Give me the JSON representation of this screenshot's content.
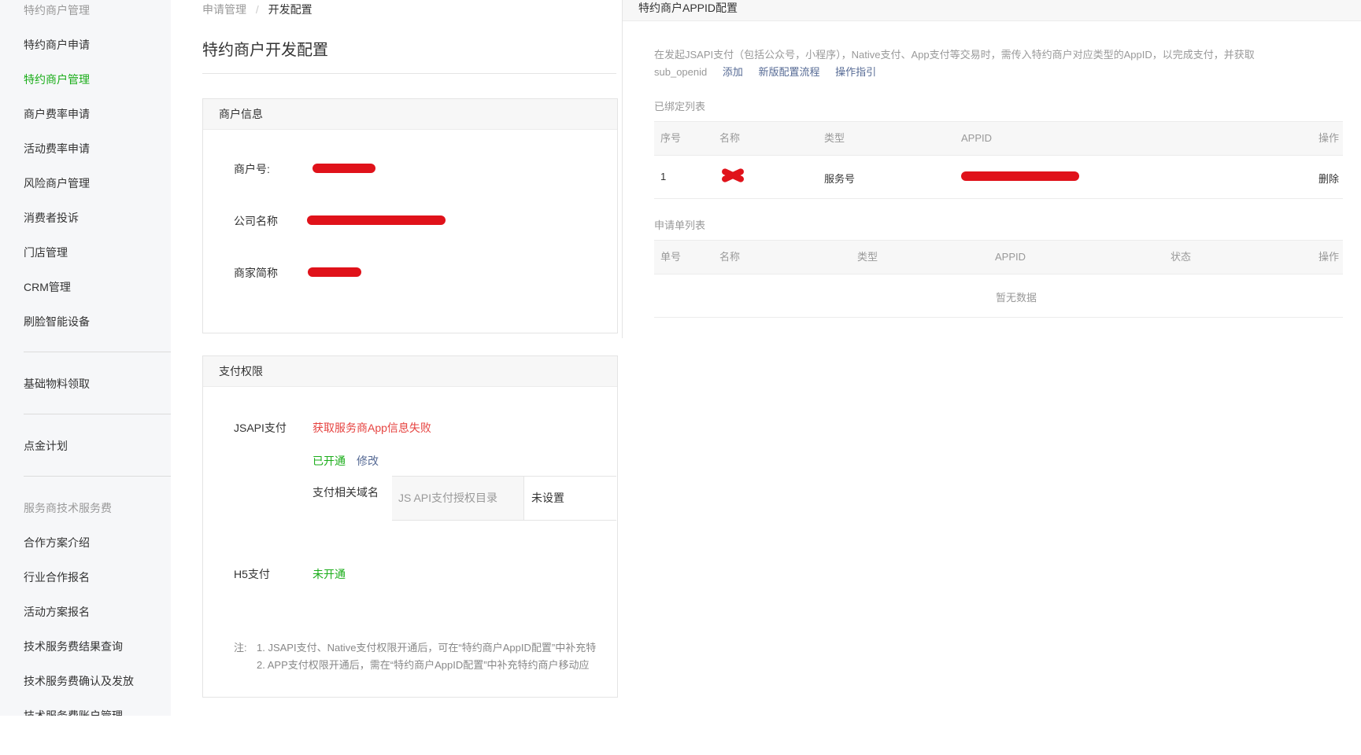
{
  "sidebar": {
    "section1_title": "特约商户管理",
    "items1": [
      "特约商户申请",
      "特约商户管理",
      "商户费率申请",
      "活动费率申请",
      "风险商户管理",
      "消费者投诉",
      "门店管理",
      "CRM管理",
      "刷脸智能设备"
    ],
    "item_basic": "基础物料领取",
    "item_gold": "点金计划",
    "section2_title": "服务商技术服务费",
    "items2": [
      "合作方案介绍",
      "行业合作报名",
      "活动方案报名",
      "技术服务费结果查询",
      "技术服务费确认及发放",
      "技术服务费账户管理"
    ]
  },
  "breadcrumb": {
    "parent": "申请管理",
    "sep": "/",
    "current": "开发配置"
  },
  "page_title": "特约商户开发配置",
  "merchant_info": {
    "title": "商户信息",
    "merchant_no_label": "商户号:",
    "company_label": "公司名称",
    "short_name_label": "商家简称"
  },
  "pay_perm": {
    "title": "支付权限",
    "jsapi_label": "JSAPI支付",
    "jsapi_error": "获取服务商App信息失败",
    "jsapi_status": "已开通",
    "jsapi_modify": "修改",
    "domain_label": "支付相关域名",
    "domain_cell": "JS API支付授权目录",
    "domain_value": "未设置",
    "h5_label": "H5支付",
    "h5_status": "未开通",
    "note_prefix": "注:",
    "note1": "1. JSAPI支付、Native支付权限开通后，可在“特约商户AppID配置”中补充特",
    "note2": "2. APP支付权限开通后，需在“特约商户AppID配置”中补充特约商户移动应"
  },
  "appid_panel": {
    "title": "特约商户APPID配置",
    "desc_line1": "在发起JSAPI支付（包括公众号，小程序），Native支付、App支付等交易时，需传入特约商户对应类型的AppID，以完成支付，并获取",
    "desc_line2": "sub_openid",
    "link_add": "添加",
    "link_flow": "新版配置流程",
    "link_guide": "操作指引",
    "bound_title": "已绑定列表",
    "bound_headers": {
      "no": "序号",
      "name": "名称",
      "type": "类型",
      "appid": "APPID",
      "op": "操作"
    },
    "bound_row": {
      "no": "1",
      "type": "服务号",
      "op": "删除"
    },
    "apply_title": "申请单列表",
    "apply_headers": {
      "no": "单号",
      "name": "名称",
      "type": "类型",
      "appid": "APPID",
      "status": "状态",
      "op": "操作"
    },
    "apply_empty": "暂无数据"
  },
  "colors": {
    "accent_green": "#1aad19",
    "link_blue": "#576b95",
    "error_red": "#e64340",
    "redaction_red": "#e0121a"
  }
}
